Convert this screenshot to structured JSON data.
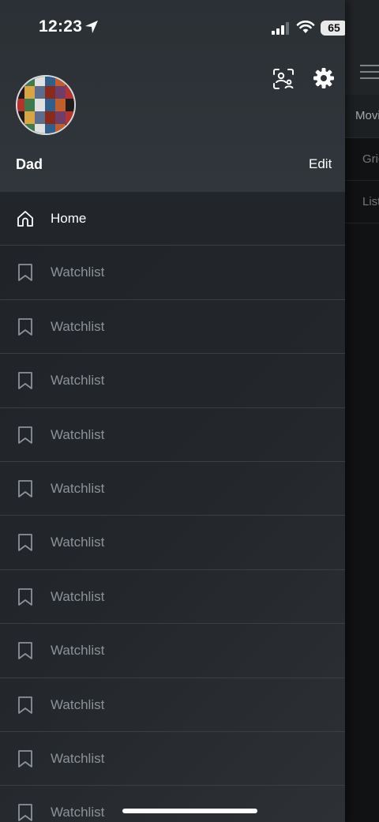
{
  "status_bar": {
    "time": "12:23",
    "battery": "65"
  },
  "background": {
    "tab_label": "Movies",
    "rows": [
      "Grid",
      "List"
    ]
  },
  "profile": {
    "name": "Dad",
    "edit_label": "Edit"
  },
  "menu": {
    "items": [
      {
        "label": "Home",
        "icon": "home-icon",
        "active": true
      },
      {
        "label": "Watchlist",
        "icon": "bookmark-icon"
      },
      {
        "label": "Watchlist",
        "icon": "bookmark-icon"
      },
      {
        "label": "Watchlist",
        "icon": "bookmark-icon"
      },
      {
        "label": "Watchlist",
        "icon": "bookmark-icon"
      },
      {
        "label": "Watchlist",
        "icon": "bookmark-icon"
      },
      {
        "label": "Watchlist",
        "icon": "bookmark-icon"
      },
      {
        "label": "Watchlist",
        "icon": "bookmark-icon"
      },
      {
        "label": "Watchlist",
        "icon": "bookmark-icon"
      },
      {
        "label": "Watchlist",
        "icon": "bookmark-icon"
      },
      {
        "label": "Watchlist",
        "icon": "bookmark-icon"
      },
      {
        "label": "Watchlist",
        "icon": "bookmark-icon"
      }
    ]
  },
  "colors": {
    "drawer_bg": "#23272b",
    "profile_bg": "#30363b",
    "active_text": "#ffffff",
    "inactive_text": "#8c9297",
    "divider": "#3a3f44"
  }
}
